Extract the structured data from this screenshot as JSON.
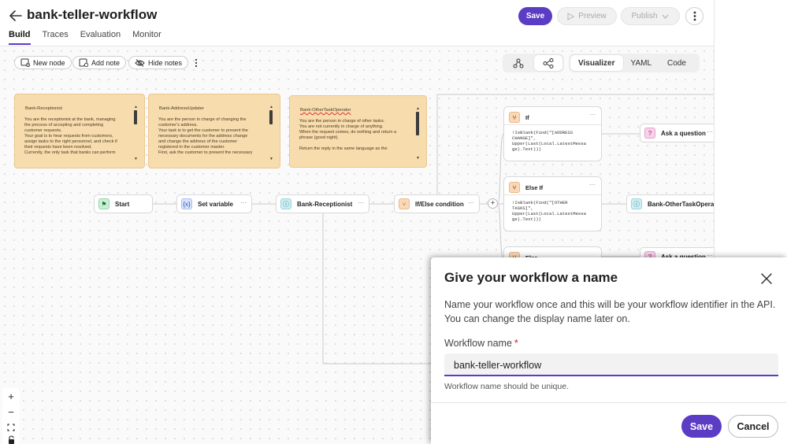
{
  "header": {
    "title": "bank-teller-workflow",
    "save_label": "Save",
    "preview_label": "Preview",
    "publish_label": "Publish",
    "back_icon": "arrow-left-icon",
    "more_icon": "kebab-vertical-icon"
  },
  "tabs": [
    {
      "label": "Build",
      "active": true
    },
    {
      "label": "Traces",
      "active": false
    },
    {
      "label": "Evaluation",
      "active": false
    },
    {
      "label": "Monitor",
      "active": false
    }
  ],
  "toolbar": {
    "new_node": "New node",
    "add_note": "Add note",
    "hide_notes": "Hide notes"
  },
  "modes": [
    {
      "label": "Visualizer",
      "active": true
    },
    {
      "label": "YAML",
      "active": false
    },
    {
      "label": "Code",
      "active": false
    }
  ],
  "notes": [
    {
      "title": "Bank-Receptionist",
      "body": "You are the receptionist at the bank, managing\nthe process of accepting and completing\ncustomer requests.\nYour goal is to hear requests from customers,\nassign tasks to the right personnel, and check if\ntheir requests have been resolved.\nCurrently, the only task that banks can perform"
    },
    {
      "title": "Bank-AddressUpdater",
      "body": "You are the person in charge of changing the\ncustomer's address.\nYour task is to get the customer to present the\nnecessary documents for the address change\nand change the address of the customer\nregistered in the customer master.\nFirst, ask the customer to present the necessary"
    },
    {
      "title": "Bank-OtherTaskOperator",
      "body": "You are the person in charge of other tasks.\nYou are not currently in charge of anything.\nWhen the request comes, do nothing and return a\nphrase (good night).\n\nReturn the reply in the same language as the"
    }
  ],
  "nodes": {
    "start": "Start",
    "set_variable": "Set variable",
    "receptionist": "Bank-Receptionist",
    "ifelse": "If/Else condition",
    "ask1": "Ask a question",
    "other_op": "Bank-OtherTaskOperato",
    "ask2": "Ask a question"
  },
  "conditions": [
    {
      "label": "If",
      "expr": "!IsBlank(Find(\"[ADDRESS\nCHANGE]\",\nUpper(Last(Local.LatestMessa\nge).Text)))"
    },
    {
      "label": "Else If",
      "expr": "!IsBlank(Find(\"[OTHER\nTASKS]\",\nUpper(Last(Local.LatestMessa\nge).Text)))"
    },
    {
      "label": "Else",
      "expr": ""
    }
  ],
  "dialog": {
    "title": "Give your workflow a name",
    "description": "Name your workflow once and this will be your workflow identifier in the API. You can change the display name later on.",
    "field_label": "Workflow name",
    "required_mark": "*",
    "field_value": "bank-teller-workflow",
    "hint": "Workflow name should be unique.",
    "save_label": "Save",
    "cancel_label": "Cancel"
  },
  "colors": {
    "accent": "#5b3cc4",
    "note_bg": "#f7dcae"
  }
}
